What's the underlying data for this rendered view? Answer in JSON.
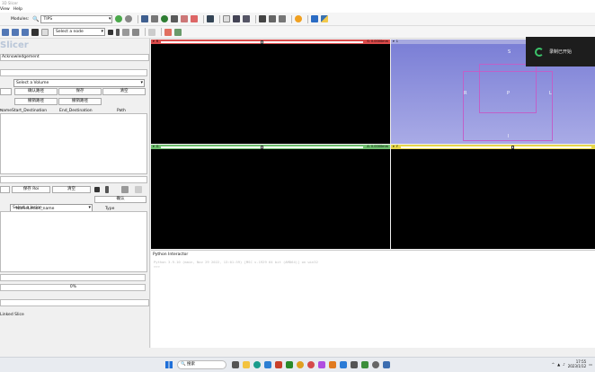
{
  "titlebar": {
    "text": "3D Slicer"
  },
  "menu": {
    "items": [
      "View",
      "Help"
    ]
  },
  "toolbar": {
    "modules_label": "Modules:",
    "module_value": "TIPS",
    "node_select": "Select a node"
  },
  "left": {
    "app_title": "Slicer",
    "acknowledgement": "Acknowledgement",
    "volume_select": "Select a Volume",
    "buttons_row1": [
      "确认路径",
      "保存",
      "清空"
    ],
    "buttons_row2": [
      "撤销路径",
      "撤销路径"
    ],
    "path_table_headers": [
      "Name",
      "Start_Destination",
      "End_Destination",
      "Path"
    ],
    "roi_buttons": [
      "保存 Roi",
      "清空"
    ],
    "lesion_select": "Select a lesion",
    "confirm_button": "确认",
    "lesion_table_headers": [
      "Name",
      "Lesion_name",
      "Type"
    ],
    "progress_text": "0%",
    "progress_value": 0,
    "bottom_label": "Linked Slice"
  },
  "views": {
    "red_label": "R",
    "red_offset": "S: 0.0000mm",
    "green_label": "G",
    "green_offset": "A: 0.0000mm",
    "yellow_label": "Y",
    "yellow_offset": "",
    "orient_labels": {
      "top": "S",
      "left": "R",
      "center": "P",
      "right": "L",
      "bottom": "I"
    }
  },
  "python": {
    "title": "Python Interactor",
    "line1": "Python 3.9.10 (main, Nov 29 2022, 13:01:39) [MSC v.1929 64 bit (AMD64)] on win32",
    "prompt": ">>>"
  },
  "popup": {
    "text": "录制已开始"
  },
  "taskbar": {
    "search_placeholder": "搜索",
    "time": "17:55",
    "date": "2023/1/12"
  },
  "colors": {
    "red": "#d94a4a",
    "green": "#6fbf6f",
    "yellow": "#e6d64a",
    "accent": "#1a73e8"
  }
}
